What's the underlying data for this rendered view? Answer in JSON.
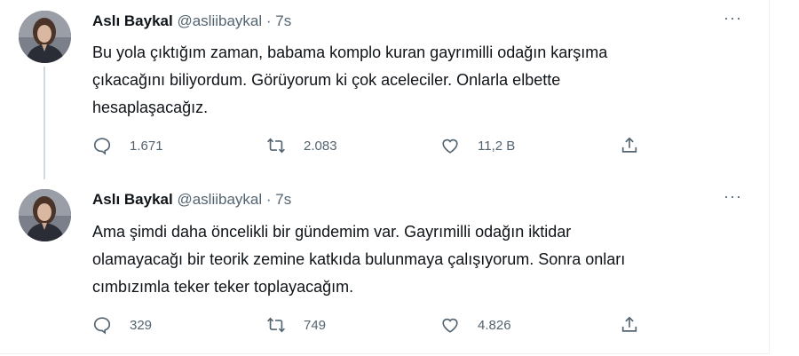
{
  "tweets": [
    {
      "author_name": "Aslı Baykal",
      "handle": "@asliibaykal",
      "separator": "·",
      "time": "7s",
      "more": "···",
      "text_lines": [
        "Bu yola çıktığım zaman, babama komplo kuran gayrımilli odağın karşıma",
        "çıkacağını biliyordum. Görüyorum ki çok aceleciler. Onlarla elbette",
        "hesaplaşacağız."
      ],
      "replies": "1.671",
      "retweets": "2.083",
      "likes": "11,2 B"
    },
    {
      "author_name": "Aslı Baykal",
      "handle": "@asliibaykal",
      "separator": "·",
      "time": "7s",
      "more": "···",
      "text_lines": [
        "Ama şimdi daha öncelikli bir gündemim var. Gayrımilli odağın iktidar",
        "olamayacağı bir teorik zemine katkıda bulunmaya çalışıyorum. Sonra onları",
        "cımbızımla teker teker toplayacağım."
      ],
      "replies": "329",
      "retweets": "749",
      "likes": "4.826"
    }
  ],
  "icons": {
    "reply": "reply-bubble-icon",
    "retweet": "retweet-icon",
    "like": "heart-icon",
    "share": "share-upload-icon",
    "more": "more-horizontal-icon"
  },
  "colors": {
    "text_primary": "#0f1419",
    "text_secondary": "#536471",
    "thread_line": "#cfd9de",
    "divider": "#eff3f4"
  }
}
